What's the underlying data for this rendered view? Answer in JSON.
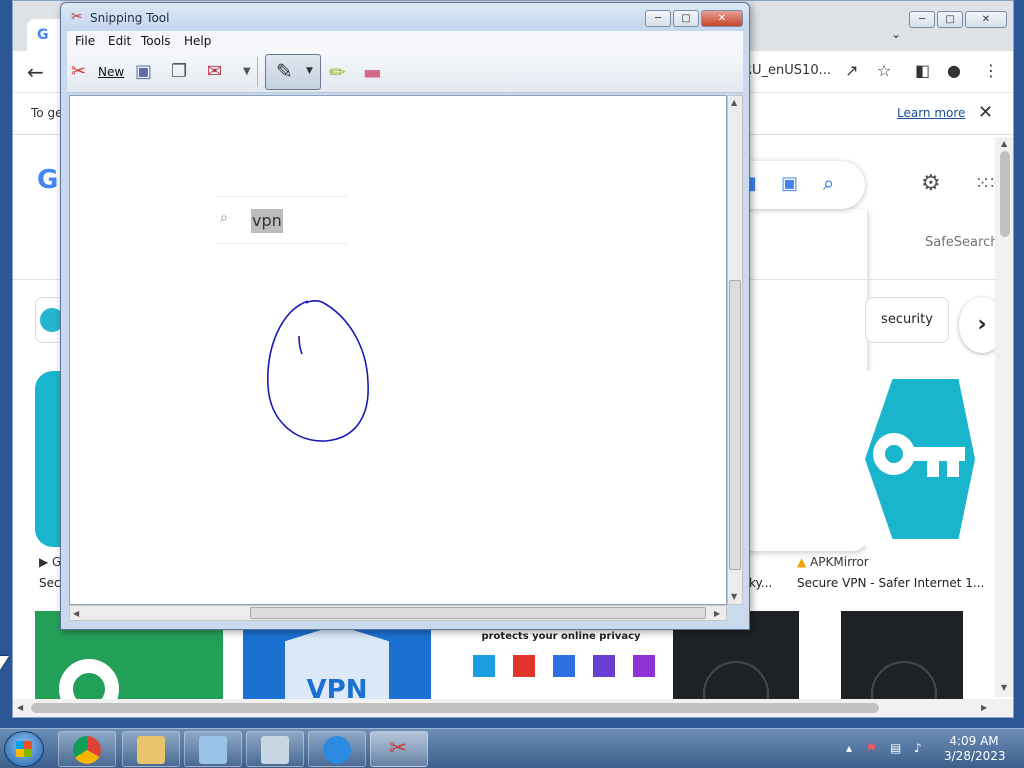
{
  "browser": {
    "tab_favicon": "G",
    "url_fragment": "RU_enUS10...",
    "infobar_text": "To ge",
    "learn_more": "Learn more",
    "safesearch": "SafeSearch",
    "chip_label": "security",
    "left_source": "G",
    "left_caption": "Secu",
    "mid_caption": "ky...",
    "source_name": "APKMirror",
    "result_caption": "Secure VPN - Safer Internet 1...",
    "privacy_title": "protects your online privacy",
    "vpn_text": "VPN",
    "google_letter": "G"
  },
  "snipping_tool": {
    "title": "Snipping Tool",
    "menu": [
      "File",
      "Edit",
      "Tools",
      "Help"
    ],
    "new_label": "New",
    "search_text": "vpn"
  },
  "taskbar": {
    "time": "4:09 AM",
    "date": "3/28/2023"
  },
  "colors": {
    "ink": "#1a1ab5",
    "accent": "#19b5cd",
    "highlight": "#bdbdbd"
  }
}
